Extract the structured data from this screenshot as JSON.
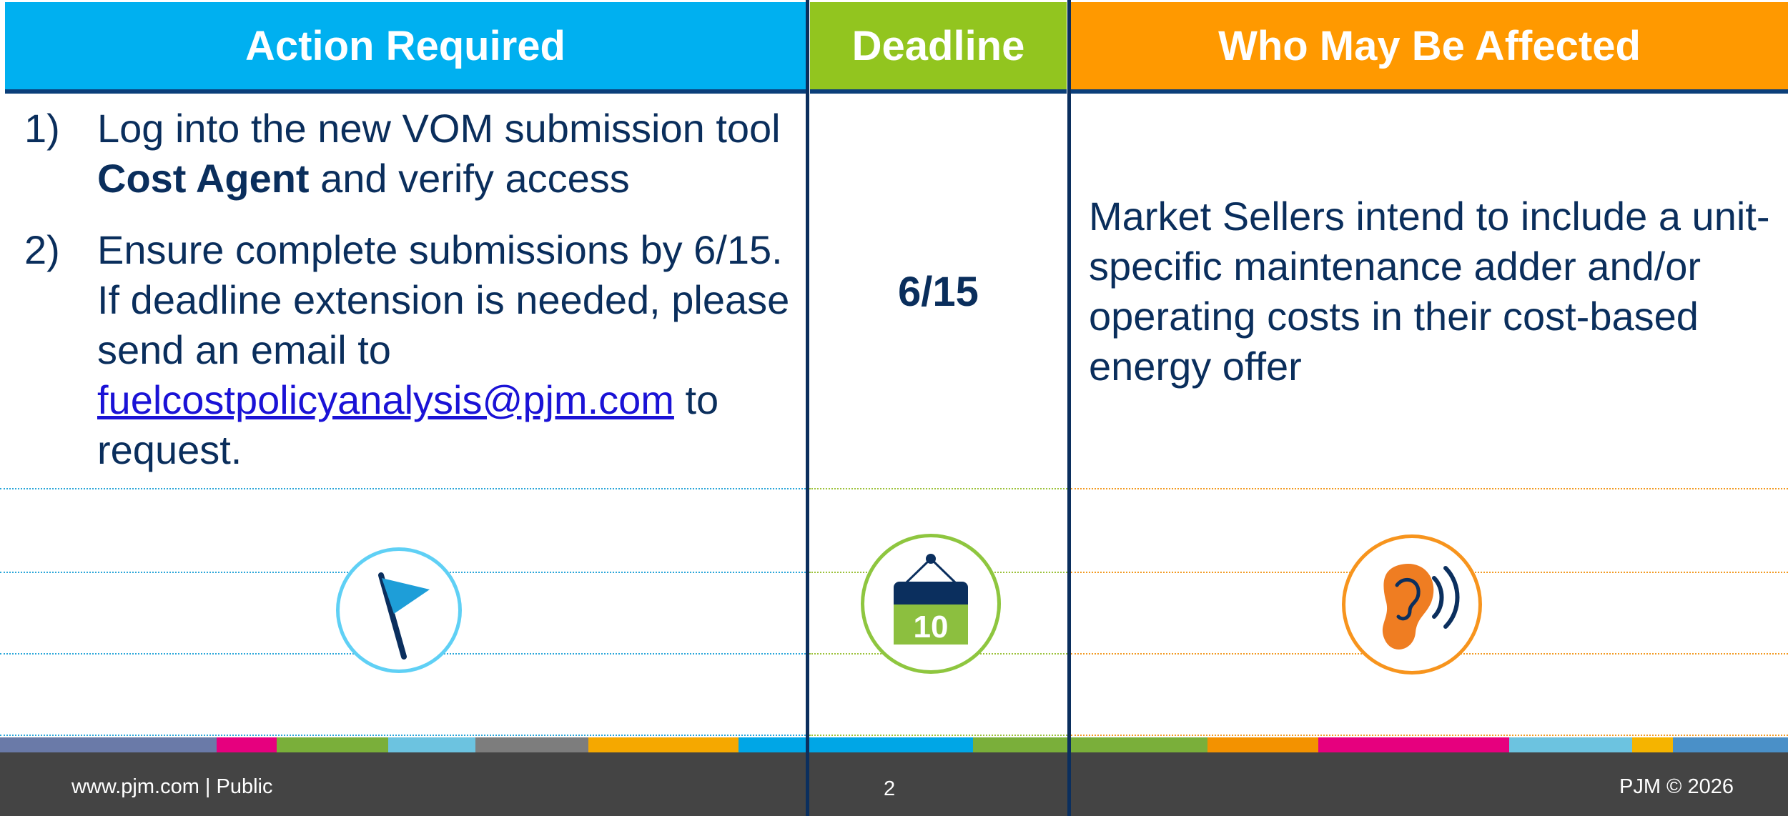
{
  "headers": {
    "action": "Action Required",
    "deadline": "Deadline",
    "who": "Who May Be Affected"
  },
  "actions": [
    {
      "num": "1)",
      "line1": "Log into the new VOM submission tool",
      "bold": "Cost Agent",
      "rest": " and verify access"
    },
    {
      "num": "2)",
      "pre": "Ensure complete submissions by 6/15. If deadline extension is needed, please send an email to ",
      "link": "fuelcostpolicyanalysis@pjm.com",
      "post": " to request."
    }
  ],
  "deadline": {
    "value": "6/15",
    "calendar_number": "10"
  },
  "who": {
    "text": "Market Sellers intend to include a unit-specific maintenance adder and/or operating costs in their cost-based energy offer"
  },
  "icons": {
    "flag": "flag-icon",
    "calendar": "calendar-icon",
    "ear": "ear-listening-icon"
  },
  "colors": {
    "action": "#00b0f0",
    "deadline": "#92c51f",
    "who": "#ff9900",
    "text": "#0a2e5c",
    "divider": "#0b2f5e",
    "footer": "#444444"
  },
  "stripe": [
    "#6a7aa8",
    "#e6007e",
    "#7aaf3a",
    "#6cc3e0",
    "#7d7d7d",
    "#f5a800",
    "#00a6e6",
    "#00a6e6",
    "#7aaf3a",
    "#7aaf3a",
    "#f39200",
    "#e6007e",
    "#6cc3e0",
    "#f5b400",
    "#4a90c8"
  ],
  "footer": {
    "left": "www.pjm.com | Public",
    "page": "2",
    "right": "PJM © 2026"
  }
}
